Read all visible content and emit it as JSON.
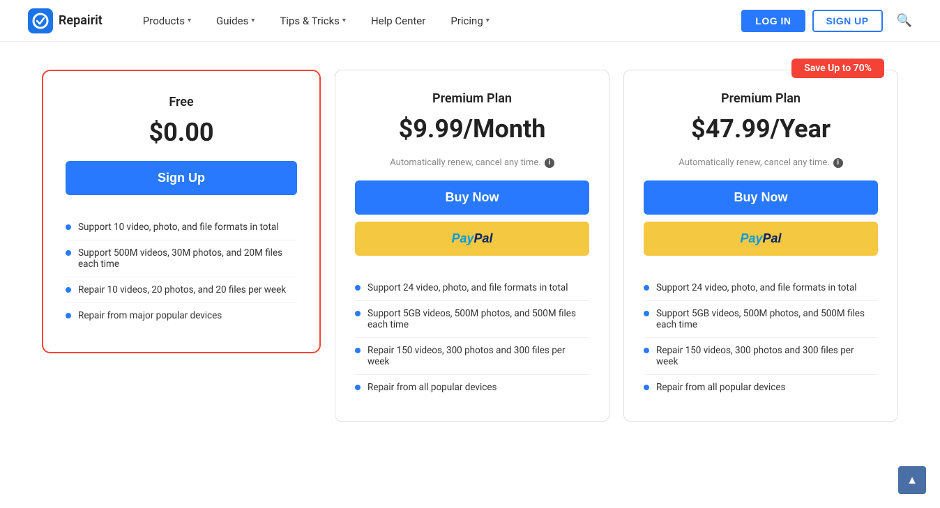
{
  "header": {
    "logo_text": "Repairit",
    "nav": [
      {
        "label": "Products",
        "has_dropdown": true
      },
      {
        "label": "Guides",
        "has_dropdown": true
      },
      {
        "label": "Tips & Tricks",
        "has_dropdown": true
      },
      {
        "label": "Help Center",
        "has_dropdown": false
      },
      {
        "label": "Pricing",
        "has_dropdown": true
      }
    ],
    "login_label": "LOG IN",
    "signup_label": "SIGN UP"
  },
  "plans": [
    {
      "id": "free",
      "name": "Free",
      "price": "$0.00",
      "highlighted": true,
      "cta_label": "Sign Up",
      "features": [
        "Support 10 video, photo, and file formats in total",
        "Support 500M videos, 30M photos, and 20M files each time",
        "Repair 10 videos, 20 photos, and 20 files per week",
        "Repair from major popular devices"
      ]
    },
    {
      "id": "monthly",
      "name": "Premium Plan",
      "price": "$9.99/Month",
      "note": "Automatically renew, cancel any time.",
      "highlighted": false,
      "cta_label": "Buy Now",
      "has_paypal": true,
      "features": [
        "Support 24 video, photo, and file formats in total",
        "Support 5GB videos, 500M photos, and 500M files each time",
        "Repair 150 videos, 300 photos and 300 files per week",
        "Repair from all popular devices"
      ]
    },
    {
      "id": "yearly",
      "name": "Premium Plan",
      "price": "$47.99/Year",
      "note": "Automatically renew, cancel any time.",
      "highlighted": false,
      "save_badge": "Save Up to 70%",
      "cta_label": "Buy Now",
      "has_paypal": true,
      "features": [
        "Support 24 video, photo, and file formats in total",
        "Support 5GB videos, 500M photos, and 500M files each time",
        "Repair 150 videos, 300 photos and 300 files per week",
        "Repair from all popular devices"
      ]
    }
  ],
  "scroll_top": "▲"
}
